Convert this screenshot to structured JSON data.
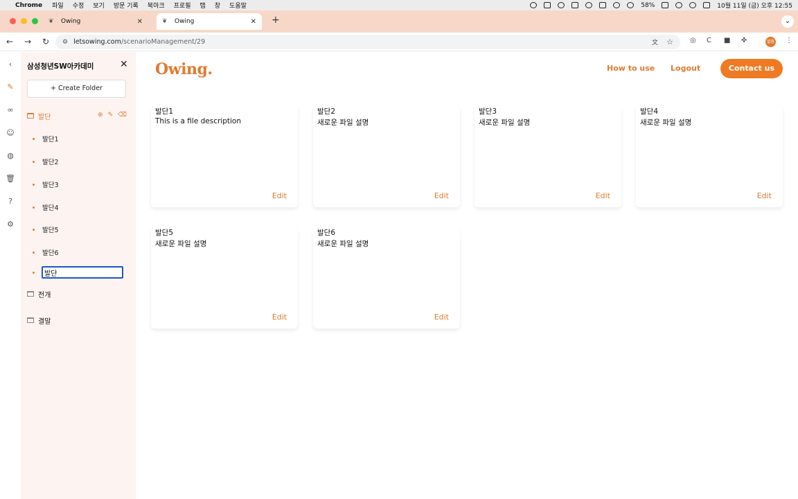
{
  "os_menubar": {
    "app": "Chrome",
    "items": [
      "파일",
      "수정",
      "보기",
      "방문 기록",
      "북마크",
      "프로필",
      "탭",
      "창",
      "도움말"
    ],
    "battery": "58%",
    "clock": "10월 11일 (금) 오후 12:55"
  },
  "browser": {
    "tabs": [
      {
        "title": "Owing",
        "active": false
      },
      {
        "title": "Owing",
        "active": true
      }
    ],
    "url_host": "letsowing.com",
    "url_path": "/scenarioManagement/29",
    "profile_initials": "없음"
  },
  "sidebar": {
    "title": "삼성청년SW아카데미",
    "create_folder": "+ Create Folder",
    "folders": [
      {
        "name": "발단",
        "active": true
      },
      {
        "name": "전개",
        "active": false
      },
      {
        "name": "결말",
        "active": false
      }
    ],
    "files": [
      "발단1",
      "발단2",
      "발단3",
      "발단4",
      "발단5",
      "발단6"
    ],
    "rename_value": "발단"
  },
  "header": {
    "logo": "Owing.",
    "how_to_use": "How to use",
    "logout": "Logout",
    "contact": "Contact us"
  },
  "cards": [
    {
      "title": "발단1",
      "desc": "This is a file description",
      "edit": "Edit"
    },
    {
      "title": "발단2",
      "desc": "새로운 파일 설명",
      "edit": "Edit"
    },
    {
      "title": "발단3",
      "desc": "새로운 파일 설명",
      "edit": "Edit"
    },
    {
      "title": "발단4",
      "desc": "새로운 파일 설명",
      "edit": "Edit"
    },
    {
      "title": "발단5",
      "desc": "새로운 파일 설명",
      "edit": "Edit"
    },
    {
      "title": "발단6",
      "desc": "새로운 파일 설명",
      "edit": "Edit"
    }
  ],
  "colors": {
    "accent": "#e07a2e",
    "button": "#ef7a23",
    "sidebar_bg": "#fdf4f1",
    "tabstrip": "#f7d8c8"
  }
}
